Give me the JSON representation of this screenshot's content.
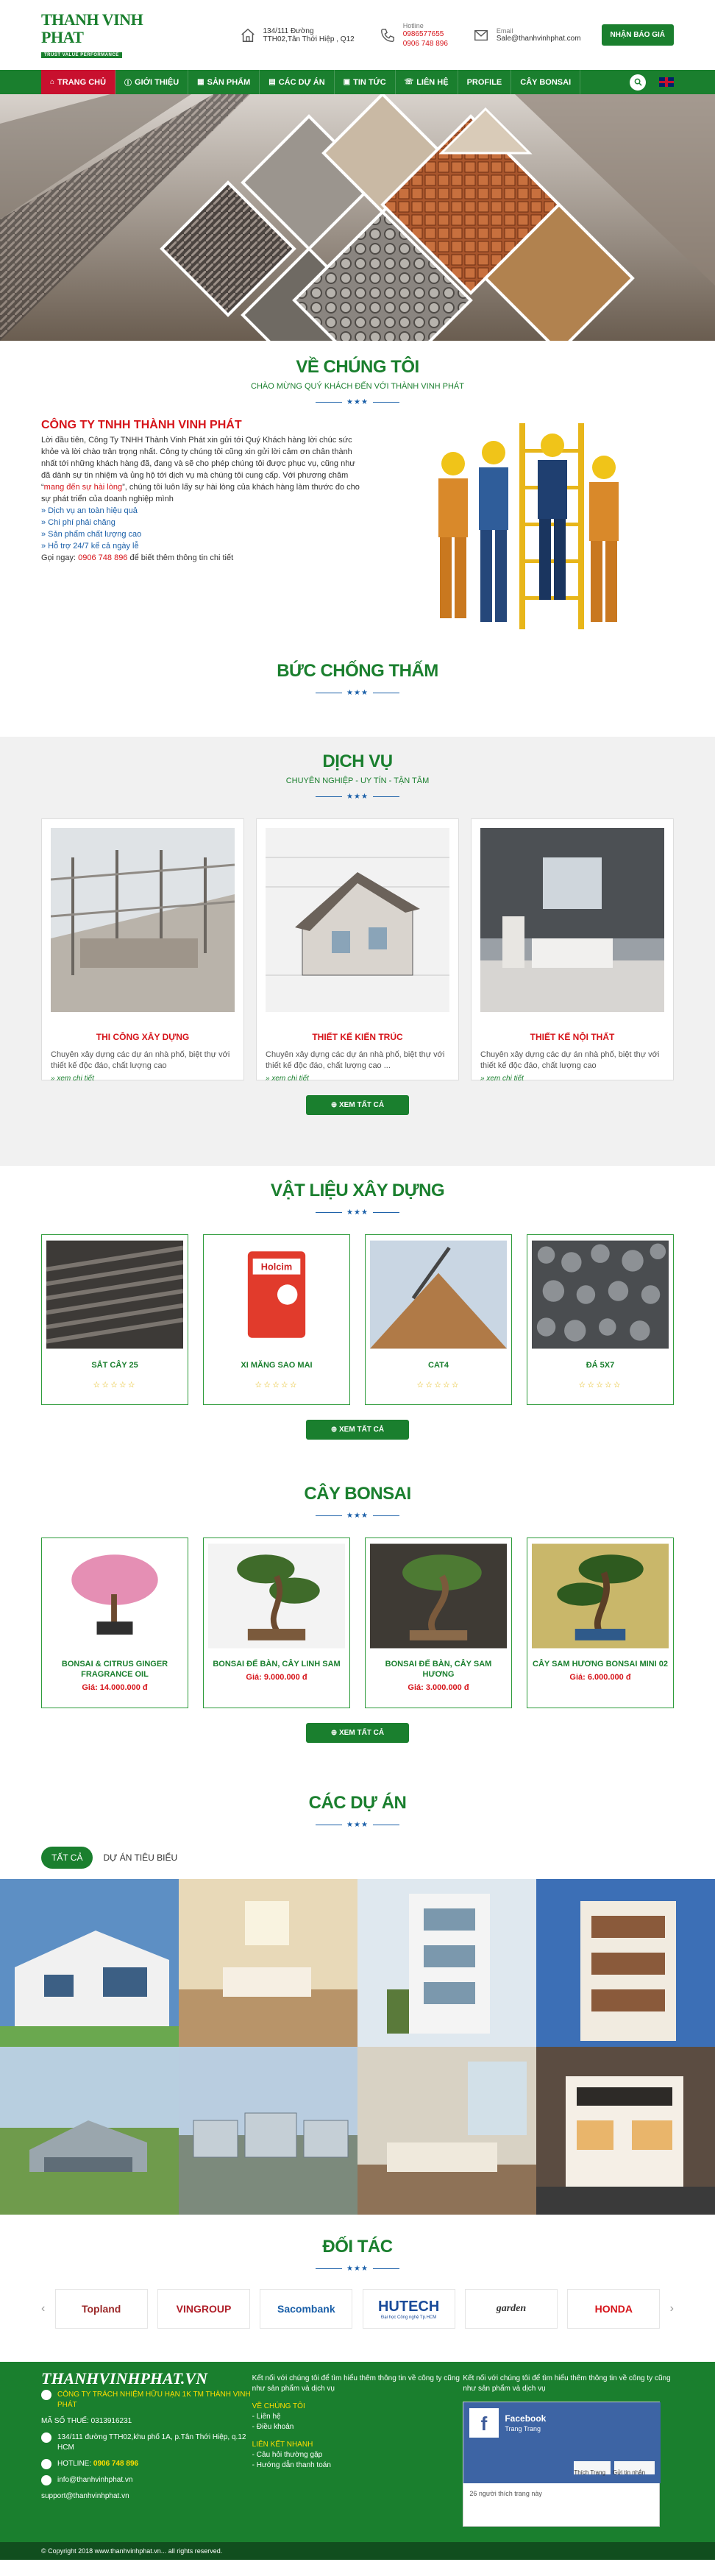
{
  "header": {
    "logo_title": "THANH VINH PHAT",
    "logo_sub": "TRUST VALUE PERFORMANCE",
    "address_line1": "134/111 Đường",
    "address_line2": "TTH02,Tân Thới Hiệp , Q12",
    "hotline_label": "Hotline",
    "hotline1": "0986577655",
    "hotline2": "0906 748 896",
    "email_label": "Email",
    "email": "Sale@thanhvinhphat.com",
    "quote_button": "NHẬN BÁO GIÁ"
  },
  "nav": {
    "items": [
      {
        "label": "TRANG CHỦ",
        "active": true
      },
      {
        "label": "GIỚI THIỆU"
      },
      {
        "label": "SẢN PHẨM"
      },
      {
        "label": "CÁC DỰ ÁN"
      },
      {
        "label": "TIN TỨC"
      },
      {
        "label": "LIÊN HỆ"
      },
      {
        "label": "PROFILE"
      },
      {
        "label": "CÂY BONSAI"
      }
    ]
  },
  "about": {
    "title": "VỀ CHÚNG TÔI",
    "subtitle": "CHÀO MỪNG QUÝ KHÁCH ĐẾN VỚI THÀNH VINH PHÁT",
    "company": "CÔNG TY TNHH THÀNH VINH PHÁT",
    "intro_a": "Lời đầu tiên, Công Ty TNHH Thành Vinh Phát xin gửi tới Quý Khách hàng lời chúc sức khỏe và lời chào trân trọng nhất. Công ty chúng tôi cũng xin gửi lời cảm ơn chân thành nhất tới những khách hàng đã, đang và sẽ cho phép chúng tôi được phục vụ, cũng như đã dành sự tin nhiệm và ủng hộ tới dịch vụ mà chúng tôi cung cấp. Với phương châm “",
    "intro_highlight": "mang đến sự hài lòng",
    "intro_b": "”, chúng tôi luôn lấy sự hài lòng của khách hàng làm thước đo cho sự phát triển của doanh nghiệp mình",
    "bullets": [
      "» Dịch vụ an toàn hiệu quả",
      "» Chi phí phải chăng",
      "» Sản phẩm chất lượng cao",
      "» Hỗ trợ 24/7 kể cả ngày lễ"
    ],
    "call_prefix": "Gọi ngay: ",
    "call_phone": "0906 748 896",
    "call_suffix": " để biết thêm thông tin chi tiết"
  },
  "waterproof": {
    "title": "BỨC CHỐNG THẤM"
  },
  "services": {
    "title": "DỊCH VỤ",
    "subtitle": "CHUYÊN NGHIỆP - UY TÍN - TẬN TÂM",
    "items": [
      {
        "title": "THI CÔNG XÂY DỰNG",
        "desc": "Chuyên xây dựng các dự án nhà phố, biệt thự với thiết kế độc đáo, chất lượng cao",
        "more": "» xem chi tiết"
      },
      {
        "title": "THIẾT KẾ KIẾN TRÚC",
        "desc": "Chuyên xây dựng các dự án nhà phố, biệt thự với thiết kế độc đáo, chất lượng cao ...",
        "more": "» xem chi tiết"
      },
      {
        "title": "THIẾT KẾ NỘI THẤT",
        "desc": "Chuyên xây dựng các dự án nhà phố, biệt thự với thiết kế độc đáo, chất lượng cao",
        "more": "» xem chi tiết"
      }
    ],
    "button": "⊕ XEM TẤT CẢ"
  },
  "materials": {
    "title": "VẬT LIỆU XÂY DỰNG",
    "items": [
      {
        "name": "SẮT CÂY 25",
        "rating": 0
      },
      {
        "name": "XI MĂNG SAO MAI",
        "rating": 0
      },
      {
        "name": "CAT4",
        "rating": 0
      },
      {
        "name": "ĐÁ 5X7",
        "rating": 0
      }
    ],
    "stars": "☆☆☆☆☆",
    "button": "⊕ XEM TẤT CẢ"
  },
  "bonsai": {
    "title": "CÂY BONSAI",
    "items": [
      {
        "name": "BONSAI & CITRUS GINGER FRAGRANCE OIL",
        "price": "Giá: 14.000.000 đ"
      },
      {
        "name": "BONSAI ĐẾ BÀN, CÂY LINH SAM",
        "price": "Giá: 9.000.000 đ"
      },
      {
        "name": "BONSAI ĐẾ BÀN, CÂY SAM HƯƠNG",
        "price": "Giá: 3.000.000 đ"
      },
      {
        "name": "CÂY SAM HƯƠNG BONSAI MINI 02",
        "price": "Giá: 6.000.000 đ"
      }
    ],
    "button": "⊕ XEM TẤT CẢ"
  },
  "projects": {
    "title": "CÁC DỰ ÁN",
    "tabs": [
      "TẤT CẢ",
      "DỰ ÁN TIÊU BIỂU"
    ]
  },
  "partners": {
    "title": "ĐỐI TÁC",
    "logos": [
      "Topland",
      "VINGROUP",
      "Sacombank",
      "HUTECH",
      "garden",
      "HONDA"
    ],
    "hutech_sub": "Đại học Công nghệ Tp.HCM"
  },
  "footer": {
    "brand": "THANHVINHPHAT.VN",
    "company": "CÔNG TY TRÁCH NHIỆM HỮU HẠN 1K TM THÀNH VINH PHÁT",
    "tax": "MÃ SỐ THUẾ: 0313916231",
    "address": "134/111 đường TTH02,khu phố 1A, p.Tân Thới Hiệp, q.12 HCM",
    "hotline_label": "HOTLINE: ",
    "hotline": "0906 748 896",
    "email1": "info@thanhvinhphat.vn",
    "email2": "support@thanhvinhphat.vn",
    "col2_intro": "Kết nối với chúng tôi để tìm hiểu thêm thông tin về công ty cũng như sản phẩm và dịch vụ",
    "col2_h1": "VỀ CHÚNG TÔI",
    "col2_links1": [
      "- Liên hệ",
      "- Điều khoản"
    ],
    "col2_h2": "LIÊN KẾT NHANH",
    "col2_links2": [
      "- Câu hỏi thường gặp",
      "- Hướng dẫn thanh toán"
    ],
    "col3_intro": "Kết nối với chúng tôi để tìm hiểu thêm thông tin về công ty cũng như sản phẩm và dịch vụ",
    "fb_title": "Facebook",
    "fb_page": "Trang Trang",
    "fb_likes": "26 người thích trang này",
    "fb_like_btn": "Thích Trang",
    "fb_share_btn": "Gửi tin nhắn"
  },
  "copyright": "© Copyright 2018 www.thanhvinhphat.vn... all rights reserved."
}
